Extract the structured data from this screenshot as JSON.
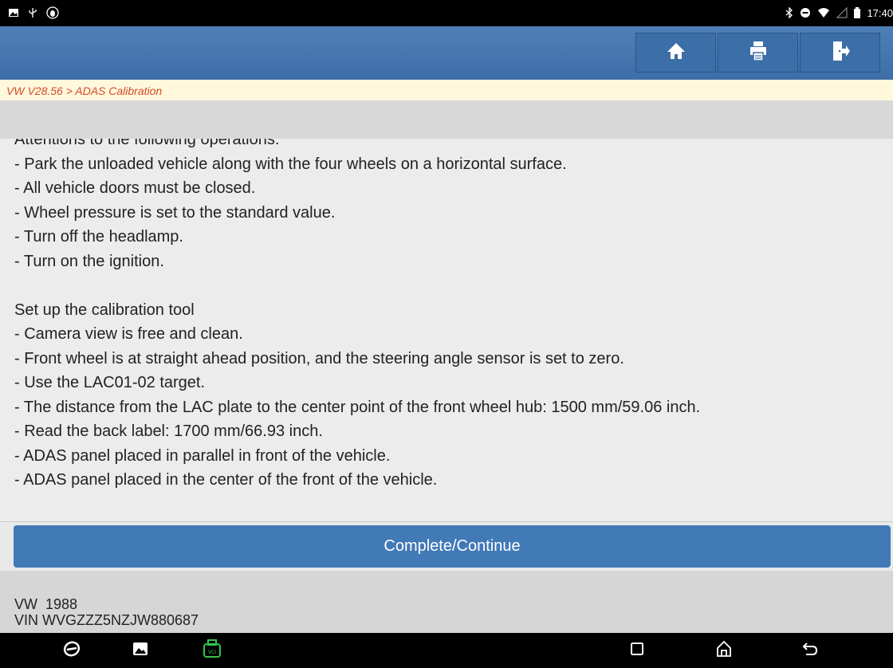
{
  "status_bar": {
    "left_icons": [
      "gallery-icon",
      "usb-icon",
      "bug-icon"
    ],
    "right_icons": [
      "bluetooth-icon",
      "dnd-icon",
      "wifi-icon",
      "signal-icon",
      "battery-icon"
    ],
    "time": "17:40"
  },
  "toolbar": {
    "buttons": [
      {
        "name": "home-icon"
      },
      {
        "name": "print-icon"
      },
      {
        "name": "exit-icon"
      }
    ]
  },
  "breadcrumb": "VW V28.56 > ADAS Calibration",
  "content": {
    "lines": [
      "Attentions to the following operations:",
      "- Park the unloaded vehicle along with the four wheels on a horizontal surface.",
      "- All vehicle doors must be closed.",
      "- Wheel pressure is set to the standard value.",
      "- Turn off the headlamp.",
      "- Turn on the ignition.",
      "",
      "Set up the calibration tool",
      "- Camera view is free and clean.",
      "- Front wheel is at straight ahead position, and the steering angle sensor is set to zero.",
      "- Use the LAC01-02 target.",
      "- The distance from the LAC plate to the center point of the front wheel hub: 1500 mm/59.06 inch.",
      "- Read the back label: 1700 mm/66.93 inch.",
      "- ADAS panel placed in parallel in front of the vehicle.",
      "- ADAS panel placed in the center of the front of the vehicle."
    ]
  },
  "action_button": "Complete/Continue",
  "vehicle_info": {
    "model": "VW  1988",
    "vin": "VIN WVGZZZ5NZJW880687"
  },
  "nav_bar": {
    "left": [
      "browser-icon",
      "gallery-icon",
      "vci-icon"
    ],
    "right": [
      "recents-icon",
      "home-icon",
      "back-icon"
    ]
  },
  "colors": {
    "appbar": "#4278b4",
    "breadcrumb_text": "#d44a2a",
    "breadcrumb_bg": "#fff8dc",
    "vci_green": "#35c44a"
  }
}
